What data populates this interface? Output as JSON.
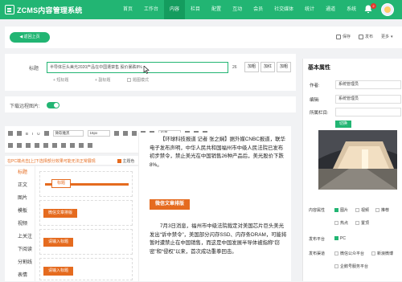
{
  "app": {
    "title": "ZCMS内容管理系统"
  },
  "nav": [
    "首页",
    "工作台",
    "内容",
    "栏目",
    "配置",
    "互动",
    "会员",
    "社交媒体",
    "统计",
    "通道",
    "系统"
  ],
  "notifications": {
    "count": "2"
  },
  "toolbar": {
    "back_label": "返回上页",
    "save_label": "保存",
    "publish_label": "发布",
    "more_label": "更多"
  },
  "form": {
    "title_label": "标题",
    "title_value": "半导体巨头美光2020产品在中国遭禁售 股价暴跌8%",
    "title_count": "26",
    "btn_bold": "加粗",
    "btn_italic": "加红",
    "btn_extra": "加粗",
    "opt_short_title": "短标题",
    "opt_sub_title": "副标题",
    "opt_lead_title": "题图模式",
    "remote_image_label": "下载远程图片:"
  },
  "editor": {
    "font_family": "微软雅黑",
    "font_size": "16px",
    "format": "段落",
    "tip_text": "在PC端点击[上]下选择部分效果可能无法正常展现",
    "theme_label": "主题色"
  },
  "template_nav": {
    "items": [
      "标题",
      "正文",
      "图片",
      "模板",
      "视频",
      "上关注",
      "下阅读",
      "分割线",
      "表情"
    ]
  },
  "templates": {
    "t1": "标题",
    "t2": "微信文章排版",
    "t3": "请输入标题",
    "t4": "请输入标题"
  },
  "content": {
    "p1": "【环球科技报道 记者 张之娴】据外媒CNBC报道，联华电子发布声明，中华人民共和国福州市中级人民法院已发布初步禁令，禁止美光在中国销售26种产品后，美光股价下跌8%。",
    "banner": "微信文章排版",
    "p2": "7月3日消息，福州市中级法院裁定对美国芯片巨头美光发出“诉中禁令”，美国部分闪存SSD、内存条DRAM，可能将暂时遭禁止在中国销售，而这是中国发展半导体被指称“窃密”和“侵权”以来，首次成功重拳回击。"
  },
  "right_panel": {
    "heading": "基本属性",
    "author_label": "作者:",
    "author_value": "系统管理员",
    "editor_label": "编辑:",
    "editor_value": "系统管理员",
    "column_label": "所属栏目:",
    "add_label": "切换",
    "content_attr_label": "内容属性",
    "opt_image": "图片",
    "opt_video": "视频",
    "opt_recommend": "推荐",
    "opt_hot": "热点",
    "opt_top": "置顶",
    "publish_platform_label": "发布平台",
    "pc_label": "PC",
    "publish_channel_label": "发布渠道",
    "opt_wechat": "微信公众平台",
    "opt_weibo": "新浪微博",
    "opt_enterprise": "企鹅号服务平台"
  },
  "colors": {
    "brand": "#22b573",
    "accent": "#e56b1f"
  }
}
